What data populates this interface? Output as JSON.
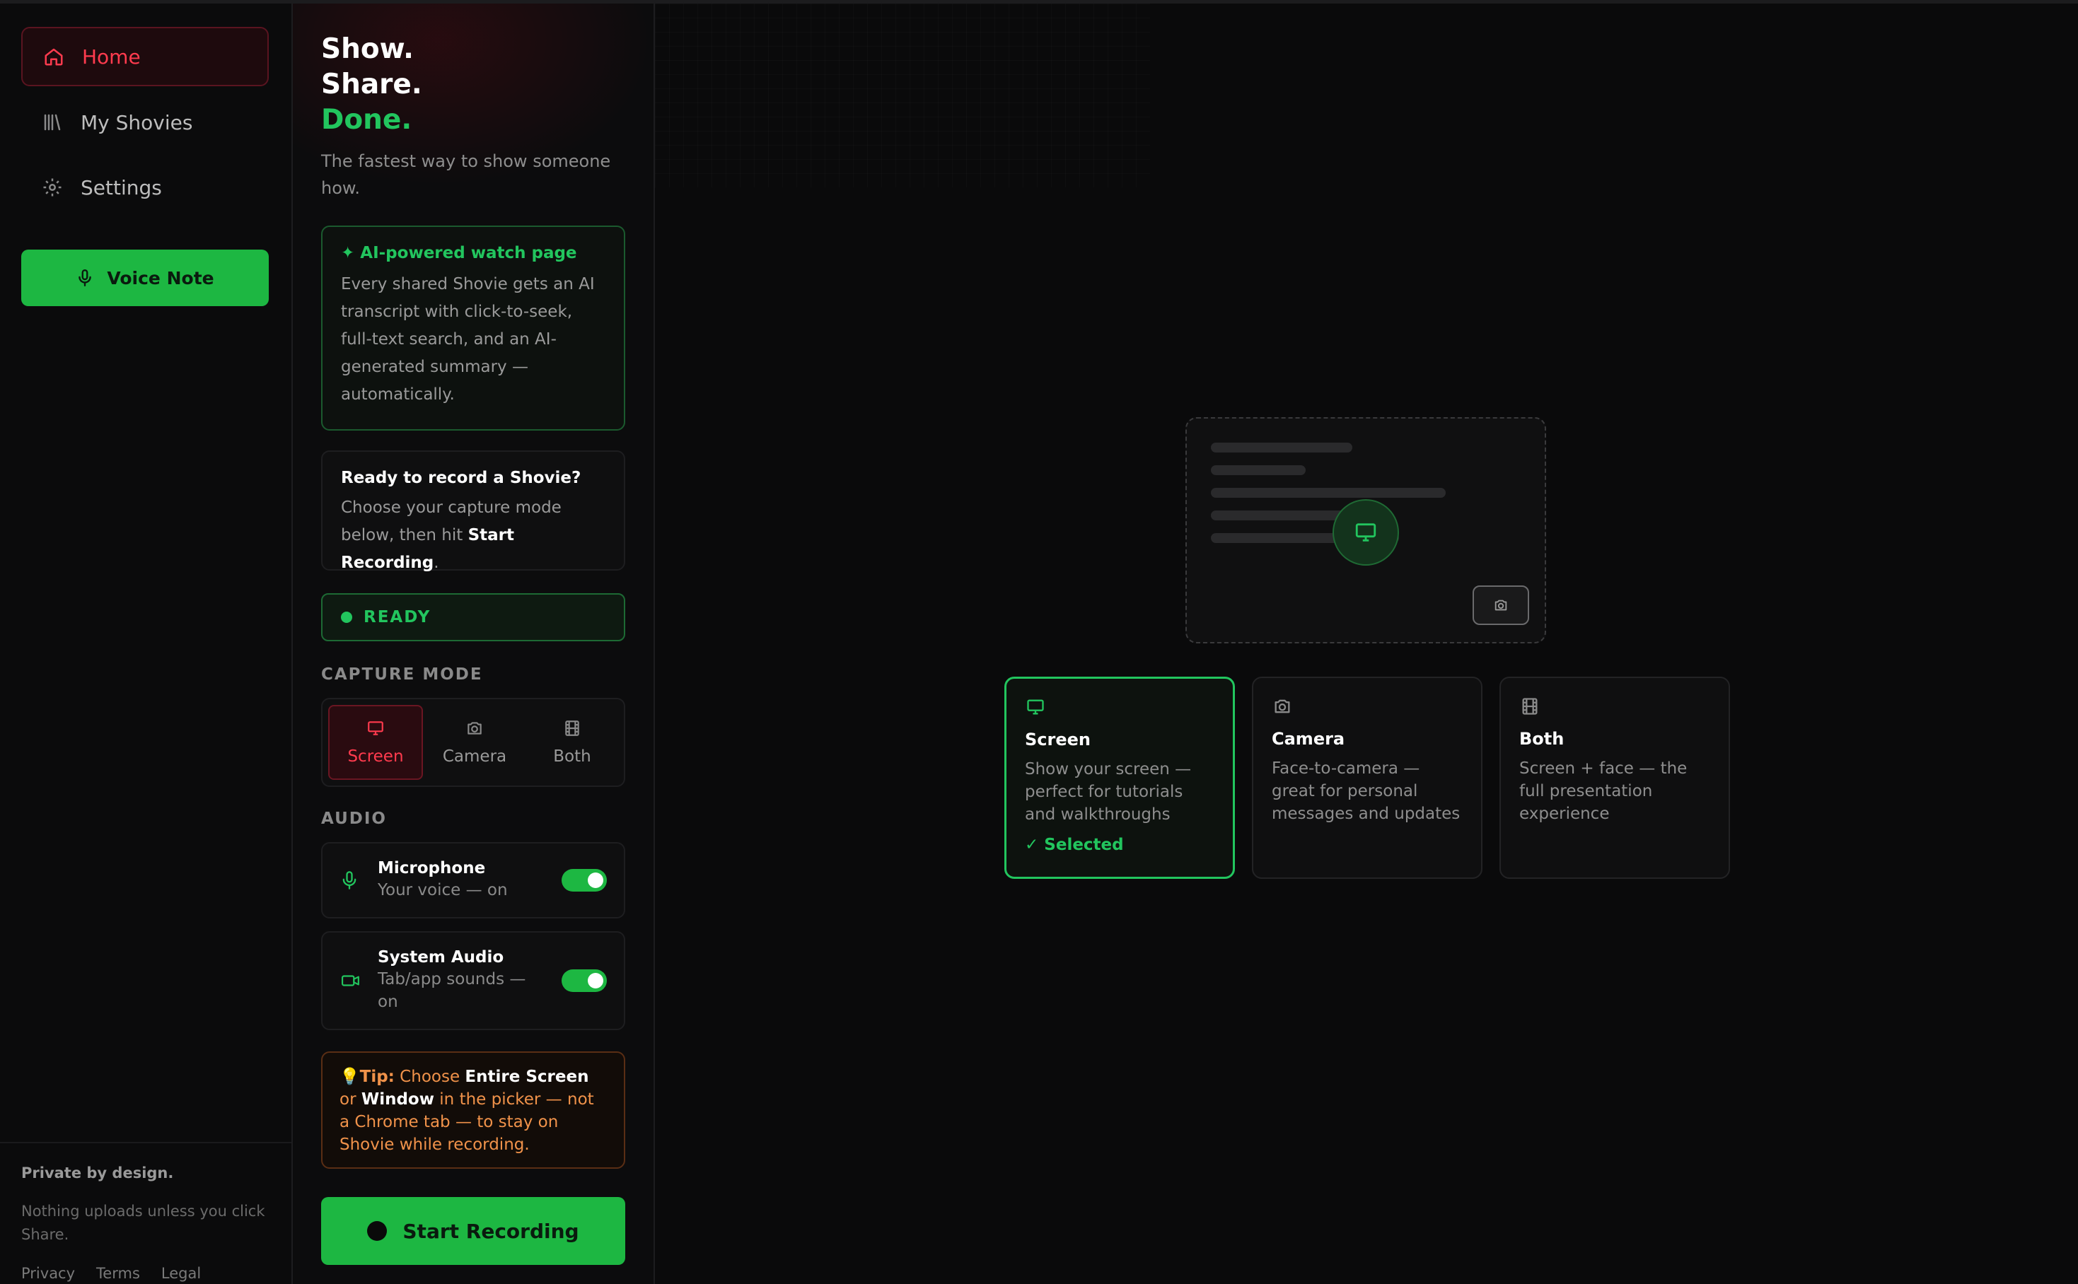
{
  "nav": {
    "items": [
      {
        "label": "Home",
        "icon": "home-icon",
        "active": true
      },
      {
        "label": "My Shovies",
        "icon": "library-icon",
        "active": false
      },
      {
        "label": "Settings",
        "icon": "gear-icon",
        "active": false
      }
    ],
    "voice_note_label": "Voice Note",
    "footer": {
      "title": "Private by design.",
      "text": "Nothing uploads unless you click Share.",
      "links": [
        "Privacy",
        "Terms",
        "Legal"
      ]
    }
  },
  "hero": {
    "line1": "Show.",
    "line2": "Share.",
    "line3": "Done.",
    "subtitle": "The fastest way to show someone how."
  },
  "ai_card": {
    "title": "✦ AI-powered watch page",
    "body": "Every shared Shovie gets an AI transcript with click-to-seek, full-text search, and an AI-generated summary — automatically."
  },
  "ready_card": {
    "title": "Ready to record a Shovie?",
    "body_prefix": "Choose your capture mode below, then hit ",
    "body_strong": "Start Recording",
    "body_suffix": "."
  },
  "status": {
    "label": "READY"
  },
  "capture": {
    "section_label": "CAPTURE MODE",
    "modes": [
      {
        "label": "Screen",
        "icon": "monitor-icon",
        "active": true
      },
      {
        "label": "Camera",
        "icon": "camera-icon",
        "active": false
      },
      {
        "label": "Both",
        "icon": "film-icon",
        "active": false
      }
    ]
  },
  "audio": {
    "section_label": "AUDIO",
    "microphone": {
      "title": "Microphone",
      "sub": "Your voice — on",
      "on": true
    },
    "system": {
      "title": "System Audio",
      "sub": "Tab/app sounds — on",
      "on": true
    }
  },
  "tip": {
    "label": "Tip:",
    "t1": " Choose ",
    "b1": "Entire Screen",
    "t2": " or ",
    "b2": "Window",
    "t3": " in the picker — not a Chrome tab — to stay on Shovie while recording."
  },
  "start_label": "Start Recording",
  "cards": [
    {
      "title": "Screen",
      "desc": "Show your screen — perfect for tutorials and walkthroughs",
      "selected_label": "Selected",
      "icon": "monitor-icon"
    },
    {
      "title": "Camera",
      "desc": "Face-to-camera — great for personal messages and updates",
      "icon": "camera-icon"
    },
    {
      "title": "Both",
      "desc": "Screen + face — the full presentation experience",
      "icon": "film-icon"
    }
  ],
  "colors": {
    "accent_green": "#22c55e",
    "accent_red": "#ff3b4e",
    "tip_orange": "#f0924a",
    "background": "#0a0a0b"
  }
}
